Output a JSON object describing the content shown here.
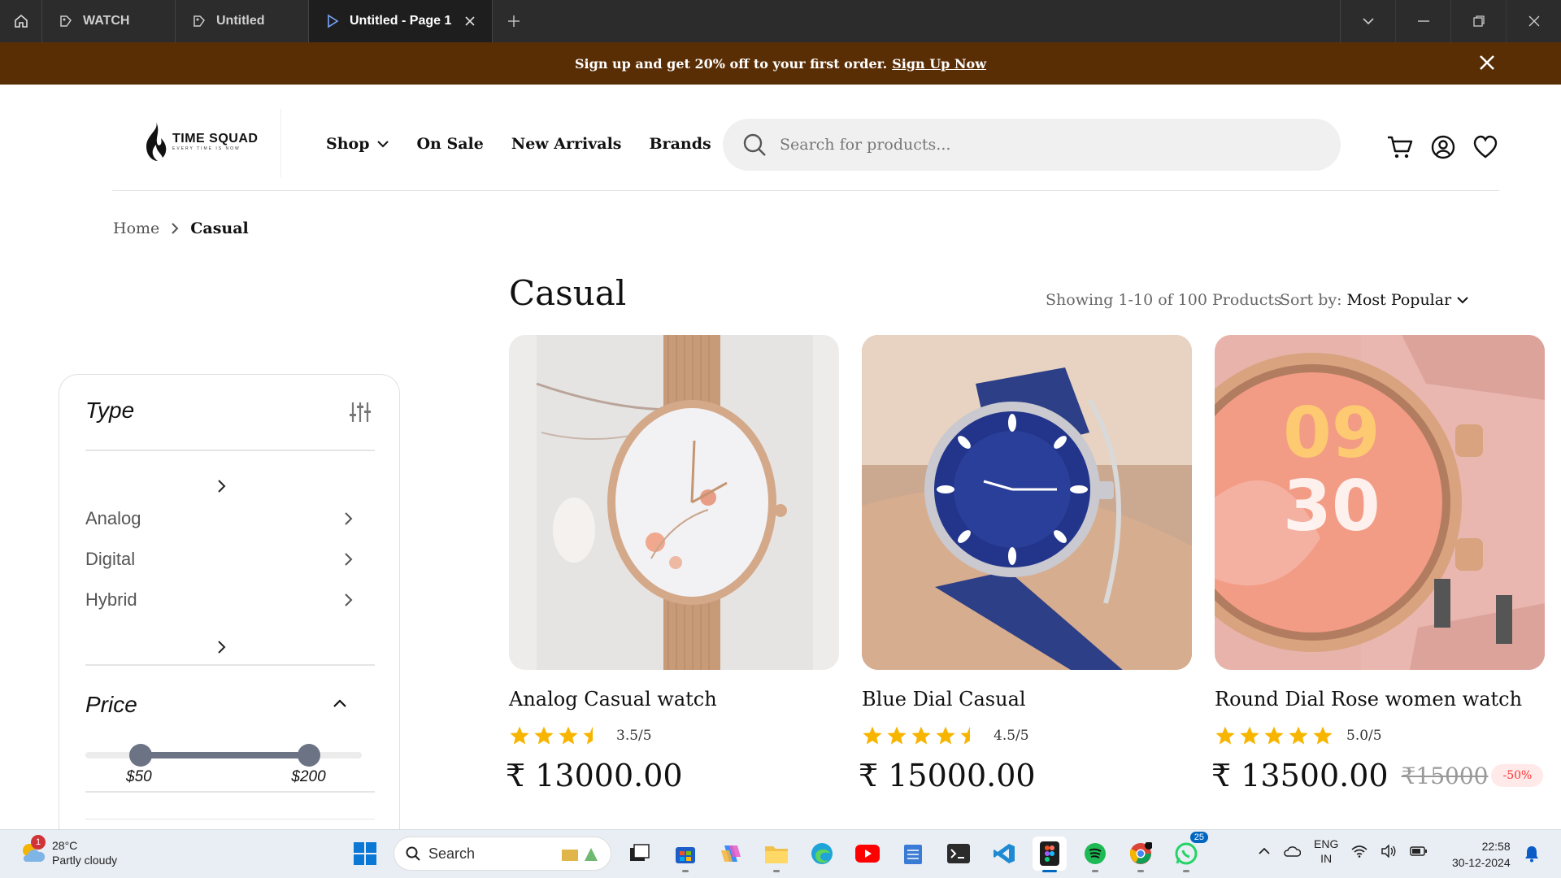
{
  "browser": {
    "tabs": [
      {
        "label": "WATCH"
      },
      {
        "label": "Untitled"
      },
      {
        "label": "Untitled - Page 1"
      }
    ]
  },
  "announcement": {
    "text": "Sign up and get 20% off to your first order.",
    "link": "Sign Up Now"
  },
  "brand": {
    "name": "TIME SQUAD",
    "tagline": "EVERY TIME IS NOW"
  },
  "nav": {
    "shop": "Shop",
    "on_sale": "On Sale",
    "new_arrivals": "New Arrivals",
    "brands": "Brands"
  },
  "search": {
    "placeholder": "Search for products..."
  },
  "breadcrumb": {
    "home": "Home",
    "current": "Casual"
  },
  "filters": {
    "type_title": "Type",
    "types": [
      "Analog",
      "Digital",
      "Hybrid"
    ],
    "price_title": "Price",
    "price_min": "$50",
    "price_max": "$200",
    "price_min_fraction": 0.2,
    "price_max_fraction": 0.81
  },
  "listing": {
    "heading": "Casual",
    "showing": "Showing 1-10 of 100 Products",
    "sort_label": "Sort by:",
    "sort_value": "Most Popular"
  },
  "products": [
    {
      "name": "Analog Casual watch",
      "rating_value": "3.5/5",
      "stars": 3.5,
      "price": "₹ 13000.00"
    },
    {
      "name": "Blue Dial Casual",
      "rating_value": "4.5/5",
      "stars": 4.5,
      "price": "₹ 15000.00"
    },
    {
      "name": "Round Dial Rose women watch",
      "rating_value": "5.0/5",
      "stars": 5,
      "price": "₹ 13500.00",
      "old_price": "₹15000",
      "discount": "-50%"
    }
  ],
  "taskbar": {
    "weather_temp": "28°C",
    "weather_desc": "Partly cloudy",
    "weather_badge": "1",
    "search_label": "Search",
    "lang_top": "ENG",
    "lang_bottom": "IN",
    "time": "22:58",
    "date": "30-12-2024",
    "whatsapp_badge": "25"
  },
  "colors": {
    "announcement_bg": "#5a2e05",
    "star": "#f7b500",
    "slider": "#6b7385",
    "discount": "#ff3333"
  }
}
